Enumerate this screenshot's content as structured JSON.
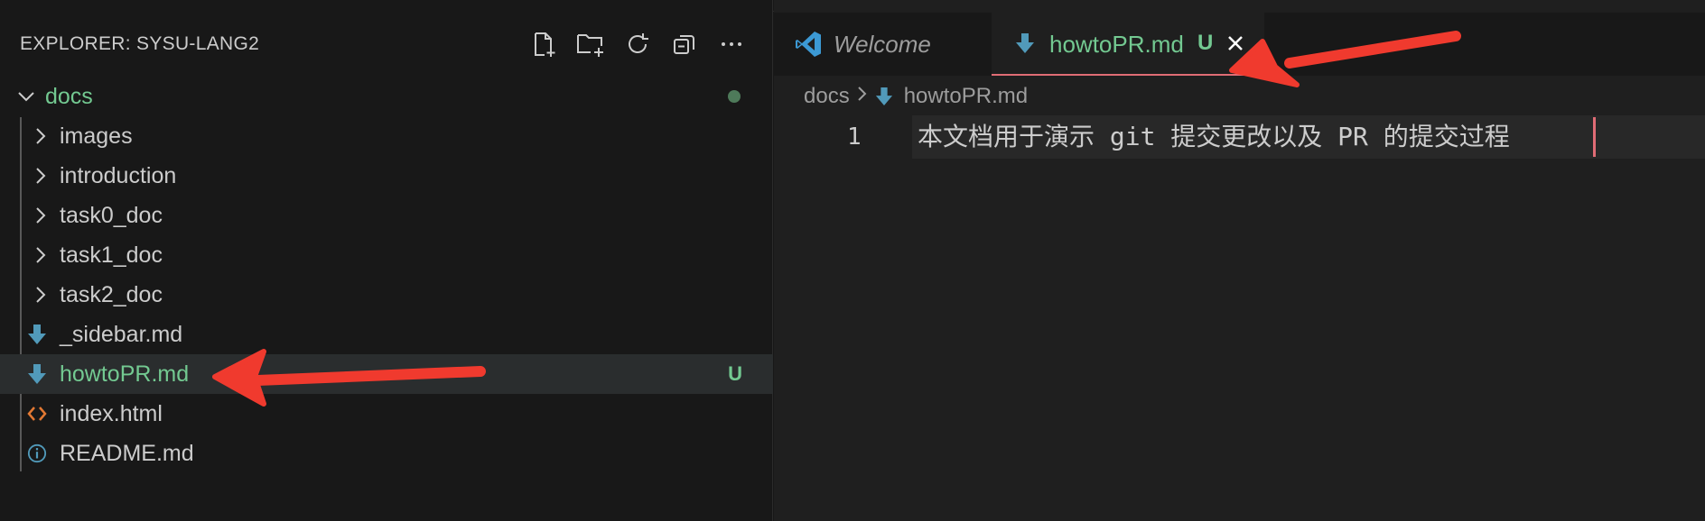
{
  "explorer": {
    "title": "EXPLORER: SYSU-LANG2",
    "actions": [
      {
        "name": "new-file-icon"
      },
      {
        "name": "new-folder-icon"
      },
      {
        "name": "refresh-icon"
      },
      {
        "name": "collapse-all-icon"
      },
      {
        "name": "more-icon"
      }
    ],
    "root": {
      "label": "docs"
    },
    "items": [
      {
        "label": "images",
        "type": "folder"
      },
      {
        "label": "introduction",
        "type": "folder"
      },
      {
        "label": "task0_doc",
        "type": "folder"
      },
      {
        "label": "task1_doc",
        "type": "folder"
      },
      {
        "label": "task2_doc",
        "type": "folder"
      },
      {
        "label": "_sidebar.md",
        "type": "markdown"
      },
      {
        "label": "howtoPR.md",
        "type": "markdown",
        "decoration": "U"
      },
      {
        "label": "index.html",
        "type": "html"
      },
      {
        "label": "README.md",
        "type": "info"
      }
    ]
  },
  "tabs": [
    {
      "label": "Welcome",
      "active": false
    },
    {
      "label": "howtoPR.md",
      "status": "U",
      "active": true
    }
  ],
  "breadcrumb": {
    "folder": "docs",
    "file": "howtoPR.md"
  },
  "editor": {
    "line_number": "1",
    "line_text": "本文档用于演示 git 提交更改以及 PR 的提交过程"
  },
  "colors": {
    "git_untracked": "#73c991",
    "annotation_arrow": "#f03a2e",
    "markdown_icon": "#519aba",
    "html_icon": "#e37933"
  }
}
